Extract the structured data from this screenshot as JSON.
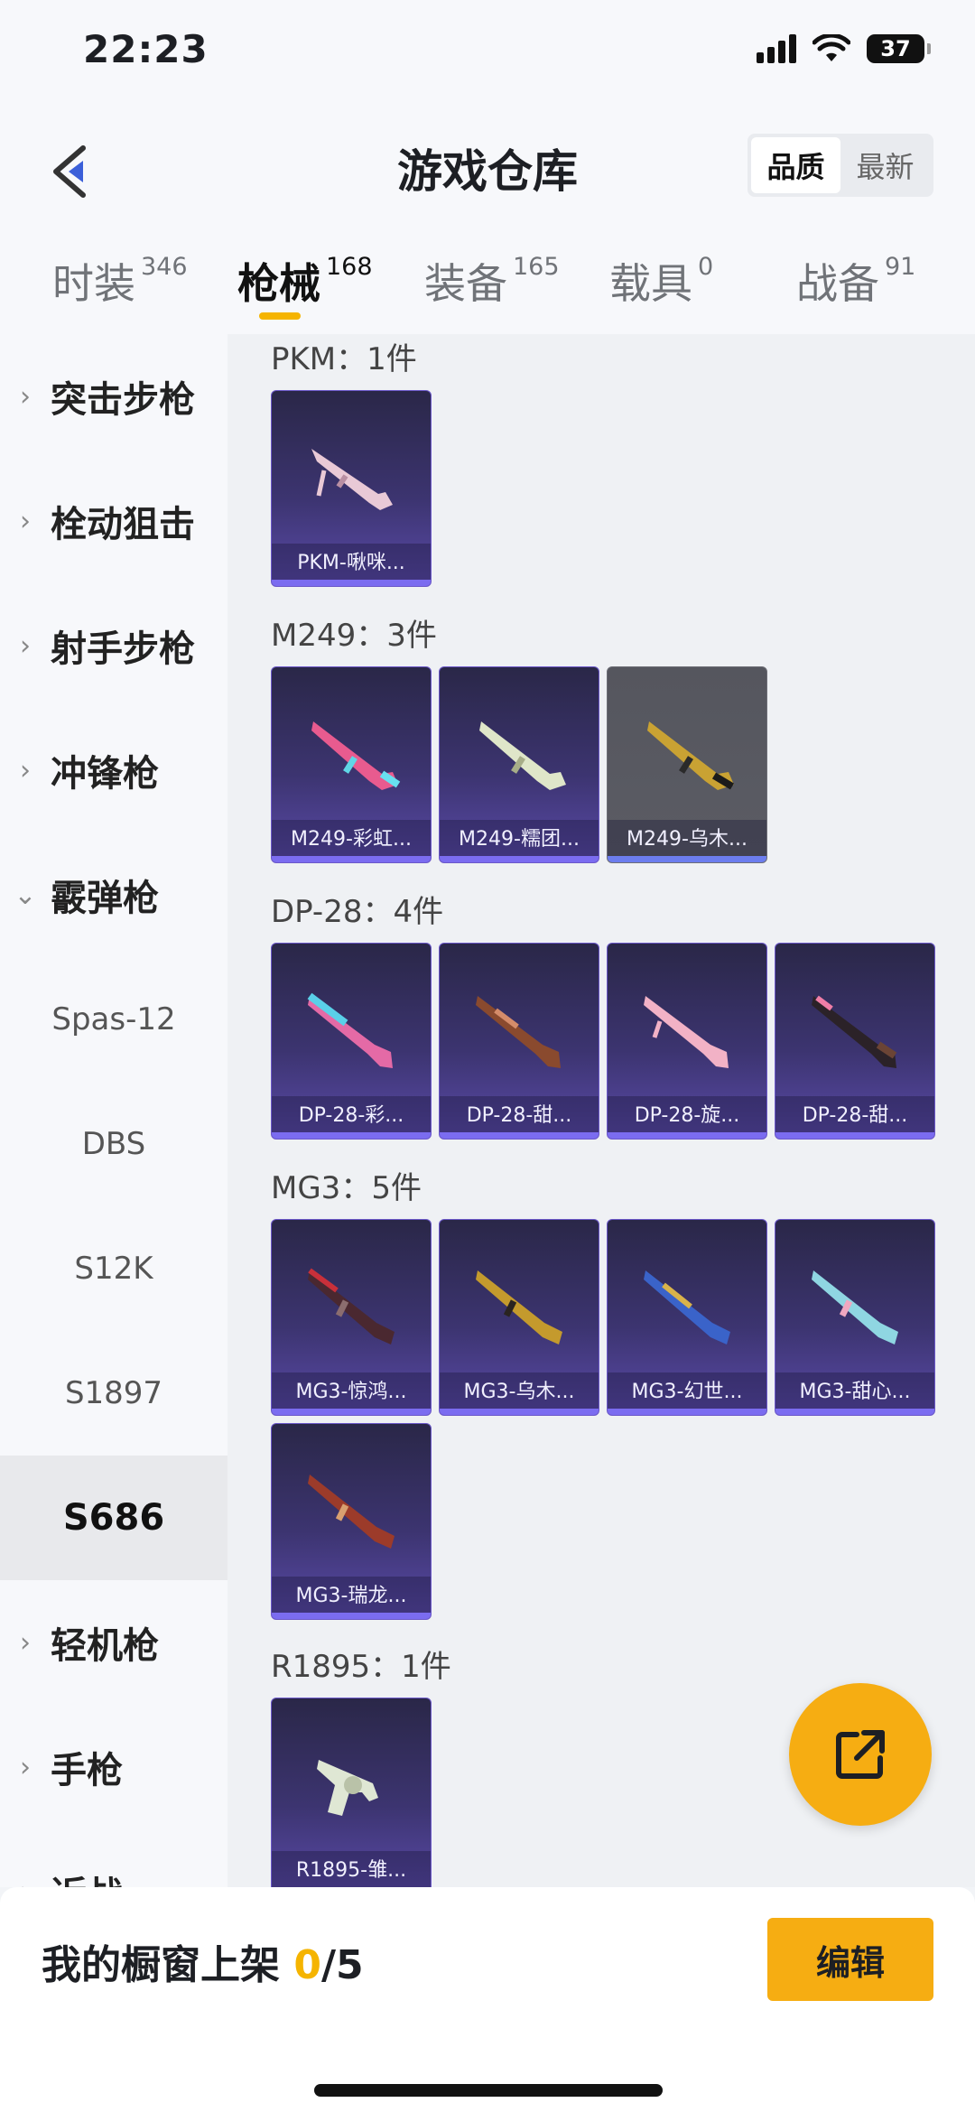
{
  "status_bar": {
    "time": "22:23",
    "battery": "37"
  },
  "header": {
    "title": "游戏仓库",
    "sort_options": [
      "品质",
      "最新"
    ],
    "sort_selected": "品质"
  },
  "tabs": [
    {
      "label": "时装",
      "count": "346"
    },
    {
      "label": "枪械",
      "count": "168",
      "active": true
    },
    {
      "label": "装备",
      "count": "165"
    },
    {
      "label": "载具",
      "count": "0"
    },
    {
      "label": "战备",
      "count": "91"
    }
  ],
  "sidebar": {
    "categories": [
      "突击步枪",
      "栓动狙击",
      "射手步枪",
      "冲锋枪",
      "霰弹枪"
    ],
    "shotgun_items": [
      "Spas-12",
      "DBS",
      "S12K",
      "S1897",
      "S686"
    ],
    "selected": "S686",
    "more_categories": [
      "轻机枪",
      "手枪",
      "近战"
    ]
  },
  "groups": [
    {
      "title": "PKM：1件",
      "items": [
        "PKM-啾咪..."
      ]
    },
    {
      "title": "M249：3件",
      "items": [
        "M249-彩虹...",
        "M249-糯团...",
        "M249-乌木..."
      ]
    },
    {
      "title": "DP-28：4件",
      "items": [
        "DP-28-彩...",
        "DP-28-甜...",
        "DP-28-旋...",
        "DP-28-甜..."
      ]
    },
    {
      "title": "MG3：5件",
      "items": [
        "MG3-惊鸿...",
        "MG3-乌木...",
        "MG3-幻世...",
        "MG3-甜心...",
        "MG3-瑞龙..."
      ]
    },
    {
      "title": "R1895：1件",
      "items": [
        "R1895-雏..."
      ]
    }
  ],
  "bottom": {
    "shelf_label": "我的橱窗上架 ",
    "shelf_used": "0",
    "shelf_total": "/5",
    "edit_label": "编辑"
  },
  "colors": {
    "accent": "#f5b400",
    "card_top": "#2a2748",
    "card_bottom": "#5a4aa8",
    "fab": "#f6ad12"
  }
}
